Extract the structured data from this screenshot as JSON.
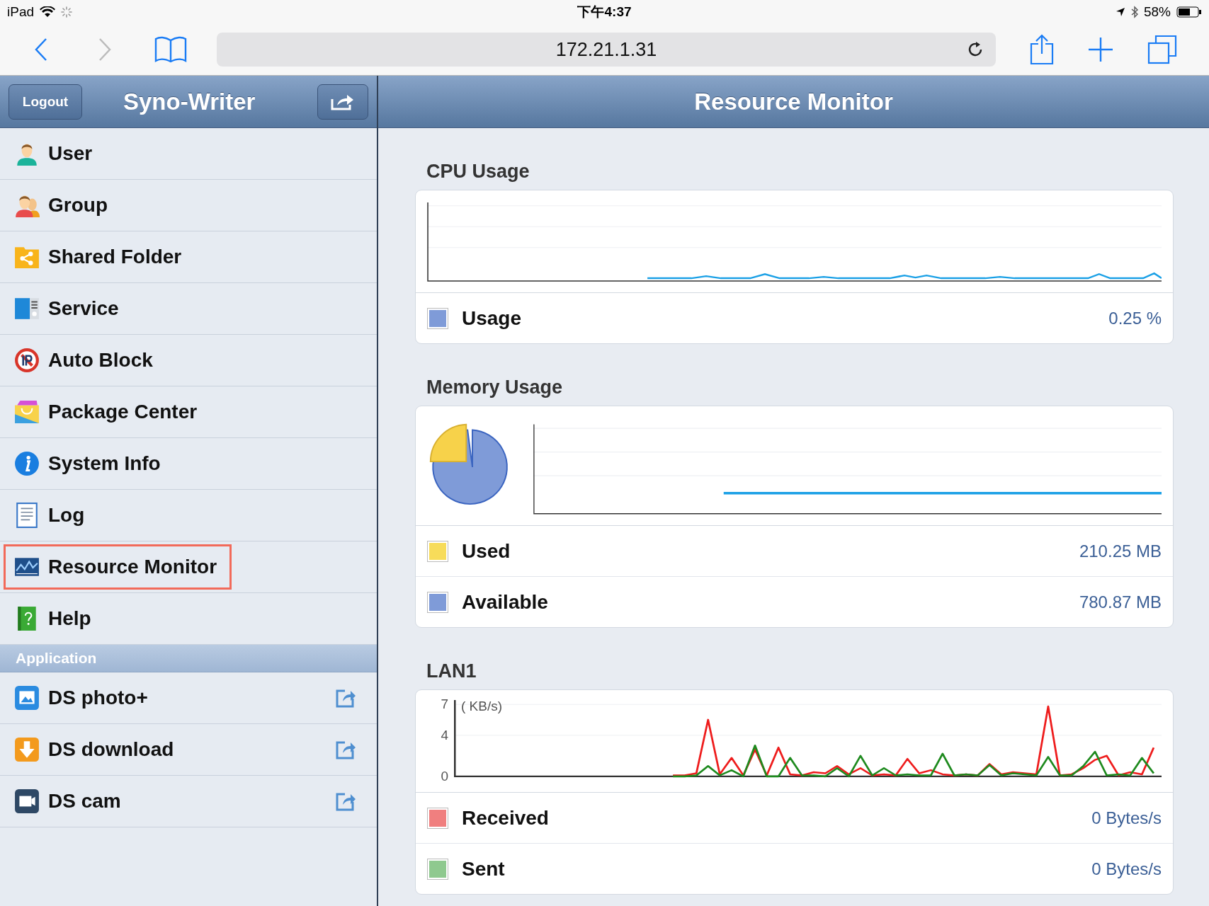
{
  "status_bar": {
    "device": "iPad",
    "time": "下午4:37",
    "battery": "58%"
  },
  "browser": {
    "back_disabled": false,
    "forward_disabled": true,
    "url": "172.21.1.31"
  },
  "sidebar": {
    "logout": "Logout",
    "title": "Syno-Writer",
    "items": [
      {
        "label": "User",
        "kind": "user",
        "selected": false
      },
      {
        "label": "Group",
        "kind": "group",
        "selected": false
      },
      {
        "label": "Shared Folder",
        "kind": "folder",
        "selected": false
      },
      {
        "label": "Service",
        "kind": "service",
        "selected": false
      },
      {
        "label": "Auto Block",
        "kind": "block",
        "selected": false
      },
      {
        "label": "Package Center",
        "kind": "package",
        "selected": false
      },
      {
        "label": "System Info",
        "kind": "info",
        "selected": false
      },
      {
        "label": "Log",
        "kind": "log",
        "selected": false
      },
      {
        "label": "Resource Monitor",
        "kind": "monitor",
        "selected": true
      },
      {
        "label": "Help",
        "kind": "help",
        "selected": false
      }
    ],
    "section": "Application",
    "apps": [
      {
        "label": "DS photo+",
        "kind": "photo"
      },
      {
        "label": "DS download",
        "kind": "download"
      },
      {
        "label": "DS cam",
        "kind": "cam"
      }
    ]
  },
  "main": {
    "title": "Resource Monitor",
    "cpu": {
      "title": "CPU Usage",
      "legend": [
        {
          "label": "Usage",
          "value": "0.25 %",
          "color": "#7f9bd8"
        }
      ]
    },
    "memory": {
      "title": "Memory Usage",
      "legend": [
        {
          "label": "Used",
          "value": "210.25 MB",
          "color": "#f7dc5a"
        },
        {
          "label": "Available",
          "value": "780.87 MB",
          "color": "#7f9bd8"
        }
      ]
    },
    "lan": {
      "title": "LAN1",
      "unit": "( KB/s)",
      "chart_data": {
        "type": "line",
        "ylim": [
          0,
          7
        ],
        "yticks": [
          0,
          4,
          7
        ],
        "series": [
          {
            "name": "Received",
            "color": "#ee1c1c",
            "values": [
              null,
              null,
              null,
              null,
              null,
              null,
              null,
              null,
              null,
              null,
              null,
              null,
              null,
              null,
              null,
              null,
              null,
              null,
              0.1,
              0.1,
              0.3,
              5.5,
              0.2,
              1.8,
              0.1,
              2.6,
              0.1,
              2.8,
              0.2,
              0.1,
              0.4,
              0.3,
              1.0,
              0.2,
              0.8,
              0.1,
              0.2,
              0.1,
              1.7,
              0.3,
              0.6,
              0.2,
              0.1,
              0.2,
              0.1,
              1.2,
              0.2,
              0.4,
              0.3,
              0.2,
              6.8,
              0.1,
              0.2,
              0.8,
              1.6,
              2.0,
              0.1,
              0.4,
              0.2,
              2.8
            ]
          },
          {
            "name": "Sent",
            "color": "#1e8a1e",
            "values": [
              null,
              null,
              null,
              null,
              null,
              null,
              null,
              null,
              null,
              null,
              null,
              null,
              null,
              null,
              null,
              null,
              null,
              null,
              0.0,
              0.0,
              0.1,
              1.0,
              0.1,
              0.6,
              0.0,
              3.0,
              0.0,
              0.0,
              1.8,
              0.1,
              0.1,
              0.0,
              0.8,
              0.0,
              2.0,
              0.1,
              0.8,
              0.1,
              0.2,
              0.1,
              0.1,
              2.2,
              0.1,
              0.2,
              0.1,
              1.1,
              0.1,
              0.3,
              0.2,
              0.1,
              1.9,
              0.1,
              0.1,
              1.0,
              2.4,
              0.1,
              0.2,
              0.1,
              1.8,
              0.3
            ]
          }
        ]
      },
      "legend": [
        {
          "value": "0 Bytes/s",
          "color": "#f07f7f"
        },
        {
          "value": "0 Bytes/s",
          "color": "#8fc98f"
        }
      ]
    }
  }
}
